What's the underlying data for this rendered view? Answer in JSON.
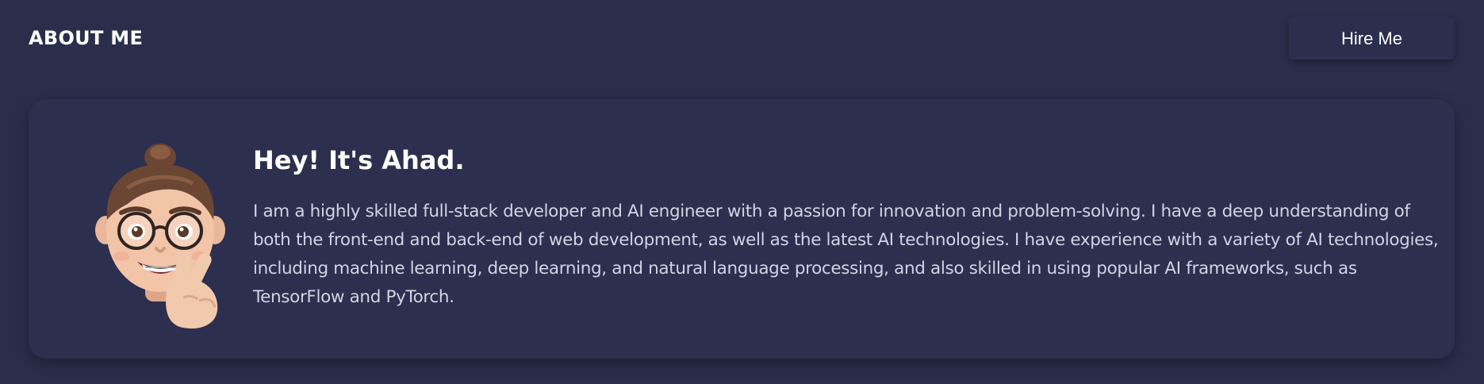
{
  "header": {
    "title": "ABOUT ME",
    "hire_label": "Hire Me"
  },
  "about": {
    "heading": "Hey! It's Ahad.",
    "body": "I am a highly skilled full-stack developer and AI engineer with a passion for innovation and problem-solving. I have a deep understanding of both the front-end and back-end of web development, as well as the latest AI technologies. I have experience with a variety of AI technologies, including machine learning, deep learning, and natural language processing, and also skilled in using popular AI frameworks, such as TensorFlow and PyTorch.",
    "avatar_icon": "memoji-peace-sign-avatar"
  },
  "colors": {
    "background": "#2b2e4b",
    "card": "#2c2f4d",
    "heading_text": "#ffffff",
    "body_text": "#d2d4e3"
  }
}
